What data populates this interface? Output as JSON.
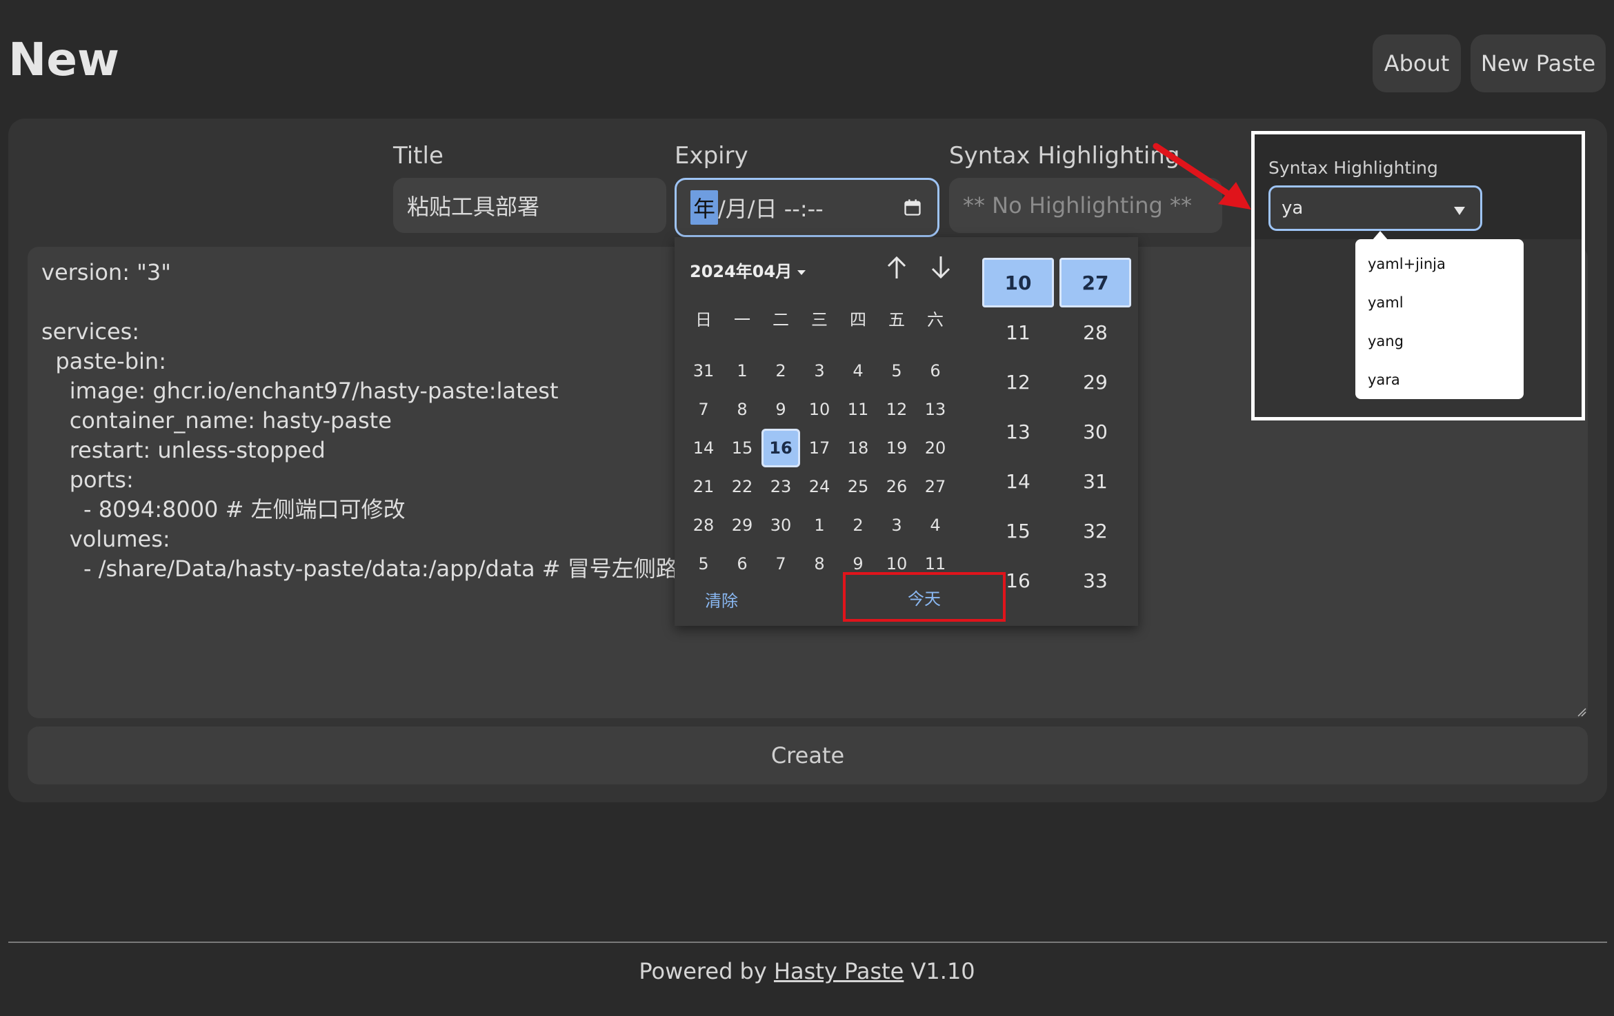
{
  "header": {
    "title": "New",
    "about_label": "About",
    "new_paste_label": "New Paste"
  },
  "form": {
    "title_label": "Title",
    "title_value": "粘贴工具部署",
    "expiry_label": "Expiry",
    "expiry_year_seg": "年",
    "expiry_rest": "/月/日 --:--",
    "syntax_label": "Syntax Highlighting",
    "syntax_placeholder": "** No Highlighting **",
    "create_label": "Create"
  },
  "code": {
    "content": "version: \"3\"\n\nservices:\n  paste-bin:\n    image: ghcr.io/enchant97/hasty-paste:latest\n    container_name: hasty-paste\n    restart: unless-stopped\n    ports:\n      - 8094:8000 # 左侧端口可修改\n    volumes:\n      - /share/Data/hasty-paste/data:/app/data # 冒号左侧路径可"
  },
  "datepicker": {
    "month_label": "2024年04月",
    "weekdays": [
      "日",
      "一",
      "二",
      "三",
      "四",
      "五",
      "六"
    ],
    "days": [
      "31",
      "1",
      "2",
      "3",
      "4",
      "5",
      "6",
      "7",
      "8",
      "9",
      "10",
      "11",
      "12",
      "13",
      "14",
      "15",
      "16",
      "17",
      "18",
      "19",
      "20",
      "21",
      "22",
      "23",
      "24",
      "25",
      "26",
      "27",
      "28",
      "29",
      "30",
      "1",
      "2",
      "3",
      "4",
      "5",
      "6",
      "7",
      "8",
      "9",
      "10",
      "11"
    ],
    "selected_day_index": 16,
    "clear_label": "清除",
    "today_label": "今天",
    "hours": [
      "10",
      "11",
      "12",
      "13",
      "14",
      "15",
      "16"
    ],
    "minutes": [
      "27",
      "28",
      "29",
      "30",
      "31",
      "32",
      "33"
    ]
  },
  "annotation": {
    "label": "Syntax Highlighting",
    "select_value": "ya",
    "options": [
      "yaml+jinja",
      "yaml",
      "yang",
      "yara"
    ],
    "highlight_color": "#e0141b"
  },
  "footer": {
    "prefix": "Powered by ",
    "link": "Hasty Paste",
    "version": " V1.10"
  },
  "colors": {
    "background": "#2a2a2a",
    "panel": "#343434",
    "accent": "#9ec4f5"
  }
}
